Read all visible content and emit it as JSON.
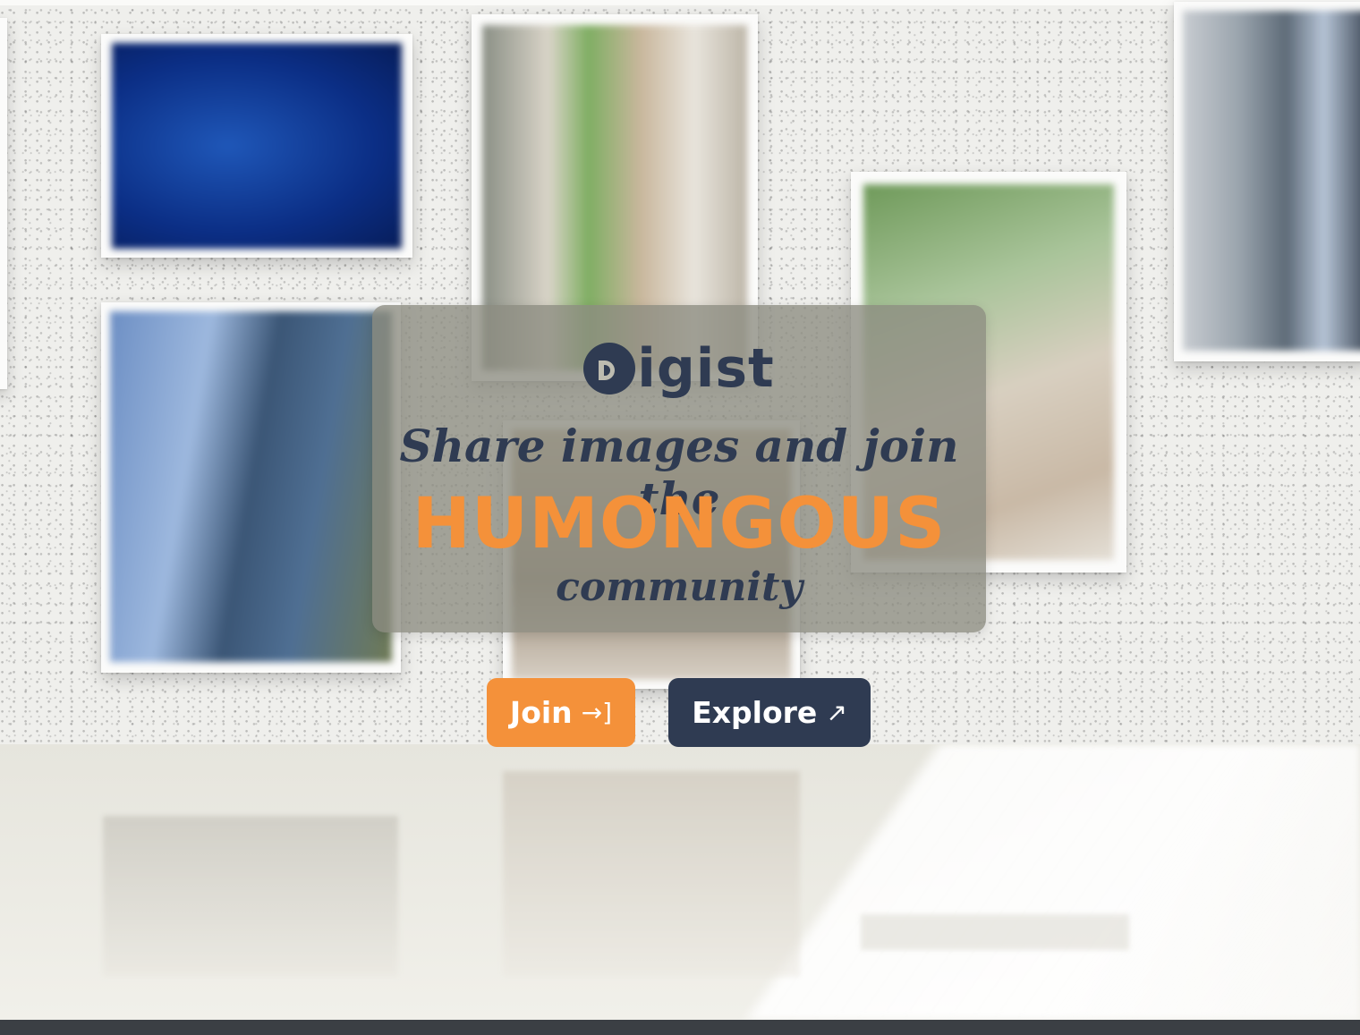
{
  "brand": {
    "name": "igist"
  },
  "hero": {
    "line1": "Share images and join the",
    "highlight": "HUMONGOUS",
    "line3": "community"
  },
  "actions": {
    "join_label": "Join",
    "join_icon": "→]",
    "explore_label": "Explore",
    "explore_icon": "↗"
  },
  "colors": {
    "accent": "#f4913a",
    "navy": "#2f3b52",
    "card": "#8c8c80"
  }
}
